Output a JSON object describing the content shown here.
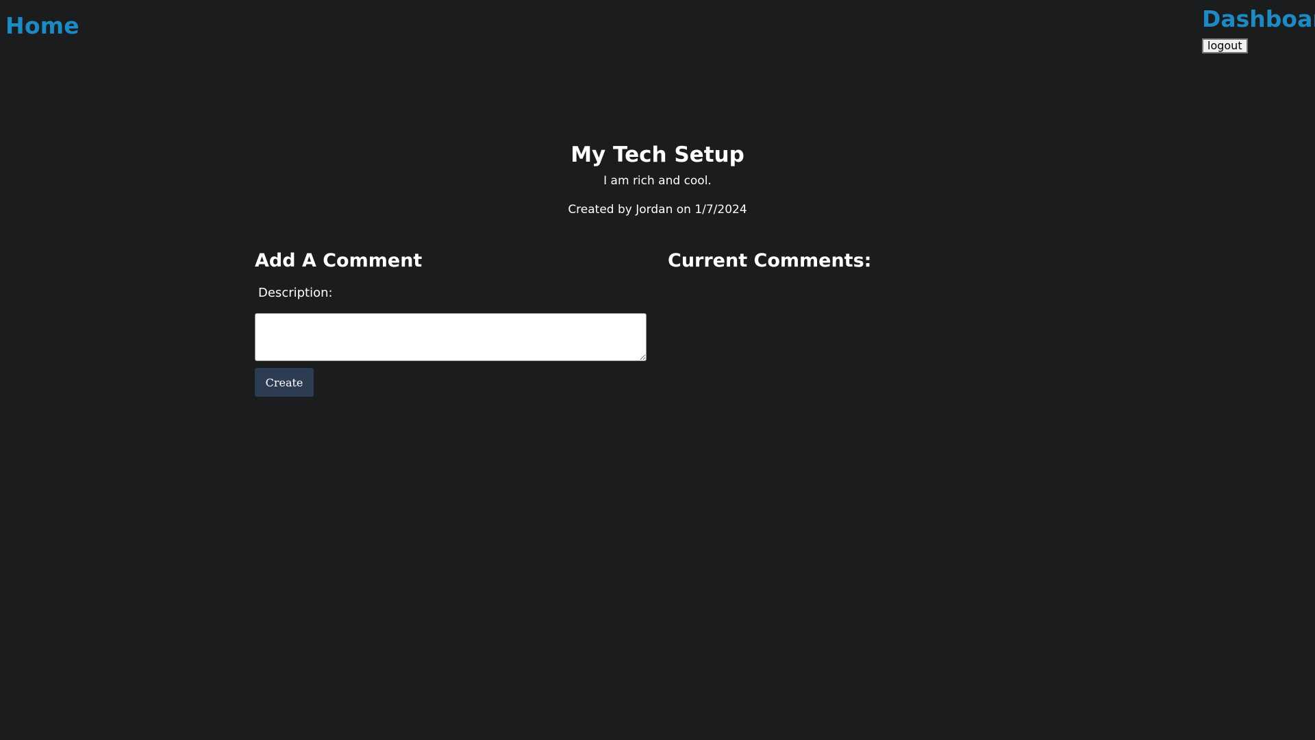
{
  "nav": {
    "home_label": "Home",
    "dashboard_label": "Dashboard",
    "logout_label": "logout"
  },
  "post": {
    "title": "My Tech Setup",
    "description": "I am rich and cool.",
    "meta": "Created by Jordan on 1/7/2024"
  },
  "add_comment": {
    "heading": "Add A Comment",
    "description_label": "Description:",
    "description_value": "",
    "create_label": "Create"
  },
  "current_comments": {
    "heading": "Current Comments:",
    "items": []
  },
  "colors": {
    "background": "#1b1c1e",
    "link": "#1e8ac4",
    "button": "#2c3c52"
  }
}
